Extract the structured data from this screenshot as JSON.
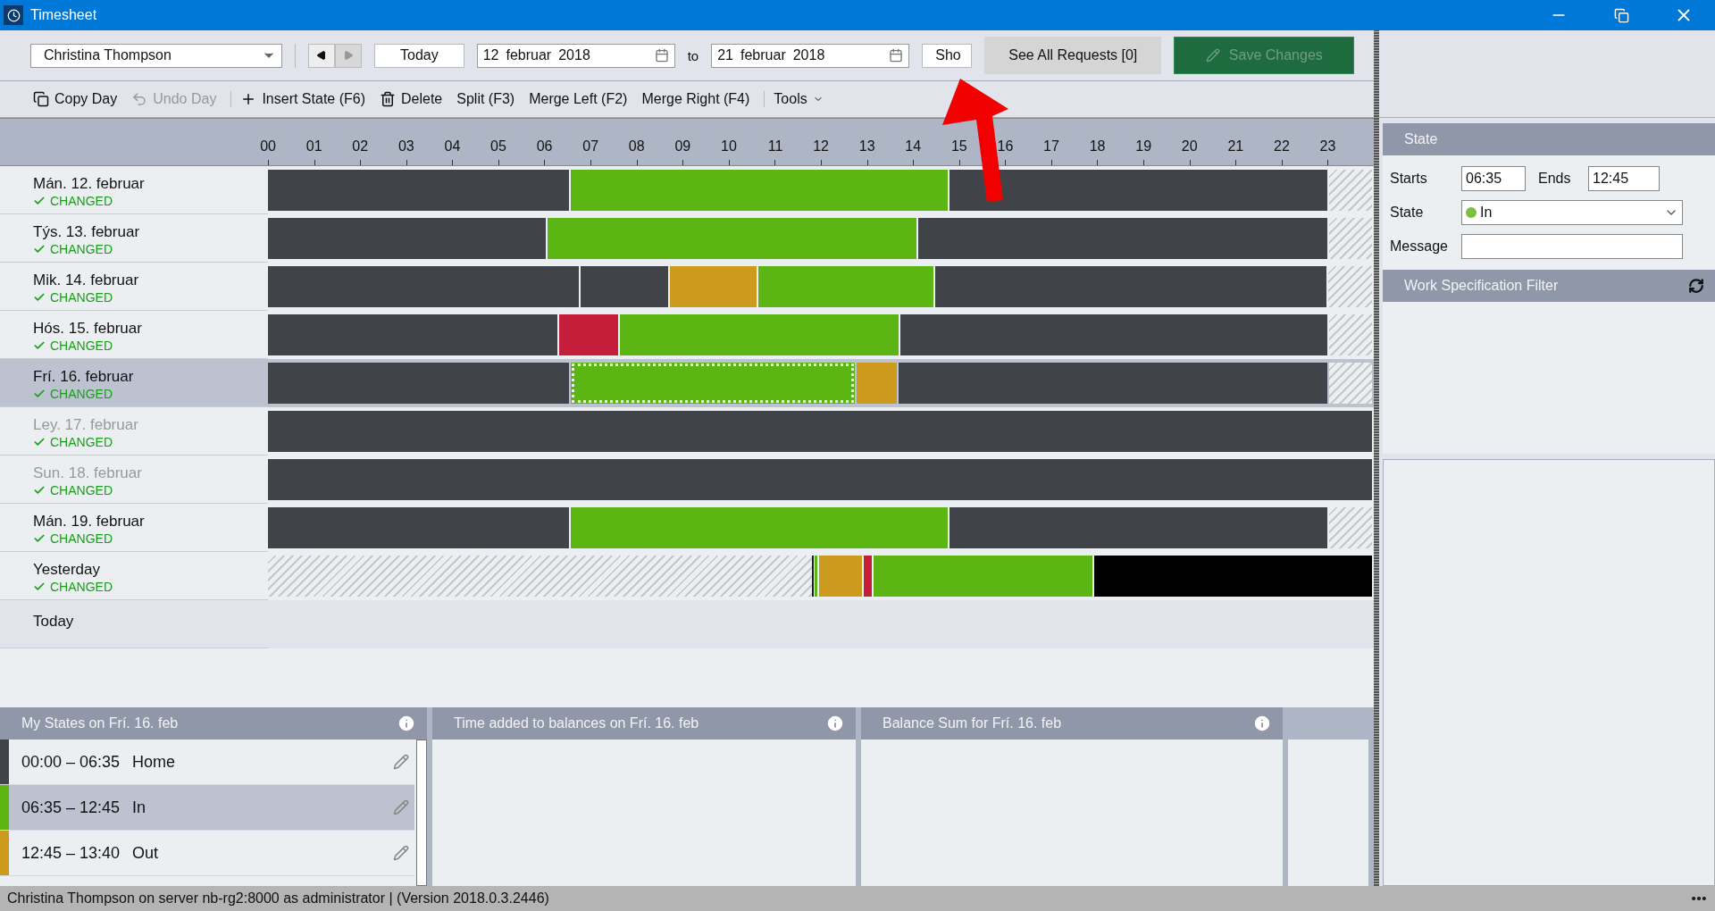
{
  "window": {
    "title": "Timesheet"
  },
  "toolbar": {
    "person": "Christina Thompson",
    "today_button": "Today",
    "from_date": {
      "day": "12",
      "month": "februar",
      "year": "2018"
    },
    "to_label": "to",
    "to_date": {
      "day": "21",
      "month": "februar",
      "year": "2018"
    },
    "show_button": "Sho",
    "requests_button": "See All Requests [0]",
    "save_button": {
      "label": "Save Changes",
      "disabled": true
    }
  },
  "actions": [
    {
      "label": "Copy Day",
      "kind": "copy",
      "disabled": false,
      "group_start": false
    },
    {
      "label": "Undo Day",
      "kind": "undo",
      "disabled": true,
      "group_start": false
    },
    {
      "label": "Insert State (F6)",
      "kind": "insert",
      "disabled": false,
      "group_start": true
    },
    {
      "label": "Delete",
      "kind": "delete",
      "disabled": false,
      "group_start": false
    },
    {
      "label": "Split (F3)",
      "kind": "plain",
      "disabled": false,
      "group_start": false
    },
    {
      "label": "Merge Left (F2)",
      "kind": "plain",
      "disabled": false,
      "group_start": false
    },
    {
      "label": "Merge Right (F4)",
      "kind": "plain",
      "disabled": false,
      "group_start": false
    },
    {
      "label": "Tools",
      "kind": "menu",
      "disabled": false,
      "group_start": true
    }
  ],
  "timeline": {
    "hours": [
      "00",
      "01",
      "02",
      "03",
      "04",
      "05",
      "06",
      "07",
      "08",
      "09",
      "10",
      "11",
      "12",
      "13",
      "14",
      "15",
      "16",
      "17",
      "18",
      "19",
      "20",
      "21",
      "22",
      "23"
    ],
    "days": [
      {
        "label": "Mán. 12. februar",
        "status": "CHANGED",
        "dimmed": false,
        "selected": false,
        "segments": [
          {
            "kind": "home",
            "level": 0.274,
            "selected": false
          },
          {
            "kind": "in",
            "level": 0.343,
            "selected": false
          },
          {
            "kind": "home",
            "level": 0.344,
            "selected": false
          },
          {
            "kind": "none",
            "level": 0.039,
            "selected": false
          }
        ]
      },
      {
        "label": "Týs. 13. februar",
        "status": "CHANGED",
        "dimmed": false,
        "selected": false,
        "segments": [
          {
            "kind": "home",
            "level": 0.253,
            "selected": false
          },
          {
            "kind": "in",
            "level": 0.336,
            "selected": false
          },
          {
            "kind": "home",
            "level": 0.372,
            "selected": false
          },
          {
            "kind": "none",
            "level": 0.039,
            "selected": false
          }
        ]
      },
      {
        "label": "Mik. 14. februar",
        "status": "CHANGED",
        "dimmed": false,
        "selected": false,
        "segments": [
          {
            "kind": "home",
            "level": 0.283,
            "selected": false
          },
          {
            "kind": "home",
            "level": 0.081,
            "selected": false
          },
          {
            "kind": "out",
            "level": 0.08,
            "selected": false
          },
          {
            "kind": "in",
            "level": 0.16,
            "selected": false
          },
          {
            "kind": "home",
            "level": 0.356,
            "selected": false
          },
          {
            "kind": "none",
            "level": 0.04,
            "selected": false
          }
        ]
      },
      {
        "label": "Hós. 15. februar",
        "status": "CHANGED",
        "dimmed": false,
        "selected": false,
        "segments": [
          {
            "kind": "home",
            "level": 0.264,
            "selected": false
          },
          {
            "kind": "absent",
            "level": 0.055,
            "selected": false
          },
          {
            "kind": "in",
            "level": 0.254,
            "selected": false
          },
          {
            "kind": "home",
            "level": 0.388,
            "selected": false
          },
          {
            "kind": "none",
            "level": 0.039,
            "selected": false
          }
        ]
      },
      {
        "label": "Frí. 16. februar",
        "status": "CHANGED",
        "dimmed": false,
        "selected": true,
        "segments": [
          {
            "kind": "home",
            "level": 0.274,
            "selected": false
          },
          {
            "kind": "in",
            "level": 0.259,
            "selected": true
          },
          {
            "kind": "out",
            "level": 0.038,
            "selected": false
          },
          {
            "kind": "home",
            "level": 0.39,
            "selected": false
          },
          {
            "kind": "none",
            "level": 0.039,
            "selected": false
          }
        ]
      },
      {
        "label": "Ley. 17. februar",
        "status": "CHANGED",
        "dimmed": true,
        "selected": false,
        "segments": [
          {
            "kind": "home",
            "level": 1,
            "selected": false
          }
        ]
      },
      {
        "label": "Sun. 18. februar",
        "status": "CHANGED",
        "dimmed": true,
        "selected": false,
        "segments": [
          {
            "kind": "home",
            "level": 1,
            "selected": false
          }
        ]
      },
      {
        "label": "Mán. 19. februar",
        "status": "CHANGED",
        "dimmed": false,
        "selected": false,
        "segments": [
          {
            "kind": "home",
            "level": 0.274,
            "selected": false
          },
          {
            "kind": "in",
            "level": 0.343,
            "selected": false
          },
          {
            "kind": "home",
            "level": 0.344,
            "selected": false
          },
          {
            "kind": "none",
            "level": 0.039,
            "selected": false
          }
        ]
      },
      {
        "label": "Yesterday",
        "status": "CHANGED",
        "dimmed": false,
        "selected": false,
        "segments": [
          {
            "kind": "none",
            "level": 0.4925,
            "selected": false
          },
          {
            "kind": "marker",
            "level": 0.003,
            "selected": false
          },
          {
            "kind": "in",
            "level": 0.004,
            "selected": false
          },
          {
            "kind": "out",
            "level": 0.04,
            "selected": false
          },
          {
            "kind": "absent",
            "level": 0.009,
            "selected": false
          },
          {
            "kind": "in",
            "level": 0.2,
            "selected": false
          },
          {
            "kind": "off",
            "level": 0.2515,
            "selected": false
          }
        ]
      }
    ],
    "today_label": "Today"
  },
  "state_panel": {
    "title": "State",
    "starts_label": "Starts",
    "starts": "06:35",
    "ends_label": "Ends",
    "ends": "12:45",
    "state_label": "State",
    "state": {
      "value": "In",
      "color": "#7cc043"
    },
    "message_label": "Message"
  },
  "filter_panel": {
    "title": "Work Specification Filter"
  },
  "bottom": {
    "my_states": {
      "title": "My States on Frí. 16. feb",
      "items": [
        {
          "time": "00:00 – 06:35",
          "state": "Home",
          "kind": "home",
          "selected": false
        },
        {
          "time": "06:35 – 12:45",
          "state": "In",
          "kind": "in",
          "selected": true
        },
        {
          "time": "12:45 – 13:40",
          "state": "Out",
          "kind": "out",
          "selected": false
        }
      ]
    },
    "balances": {
      "title": "Time added to balances on Frí. 16. feb"
    },
    "balance_sum": {
      "title": "Balance Sum for Frí. 16. feb"
    }
  },
  "status_bar": {
    "text": "Christina Thompson on server nb-rg2:8000 as administrator  |  (Version 2018.0.3.2446)"
  }
}
